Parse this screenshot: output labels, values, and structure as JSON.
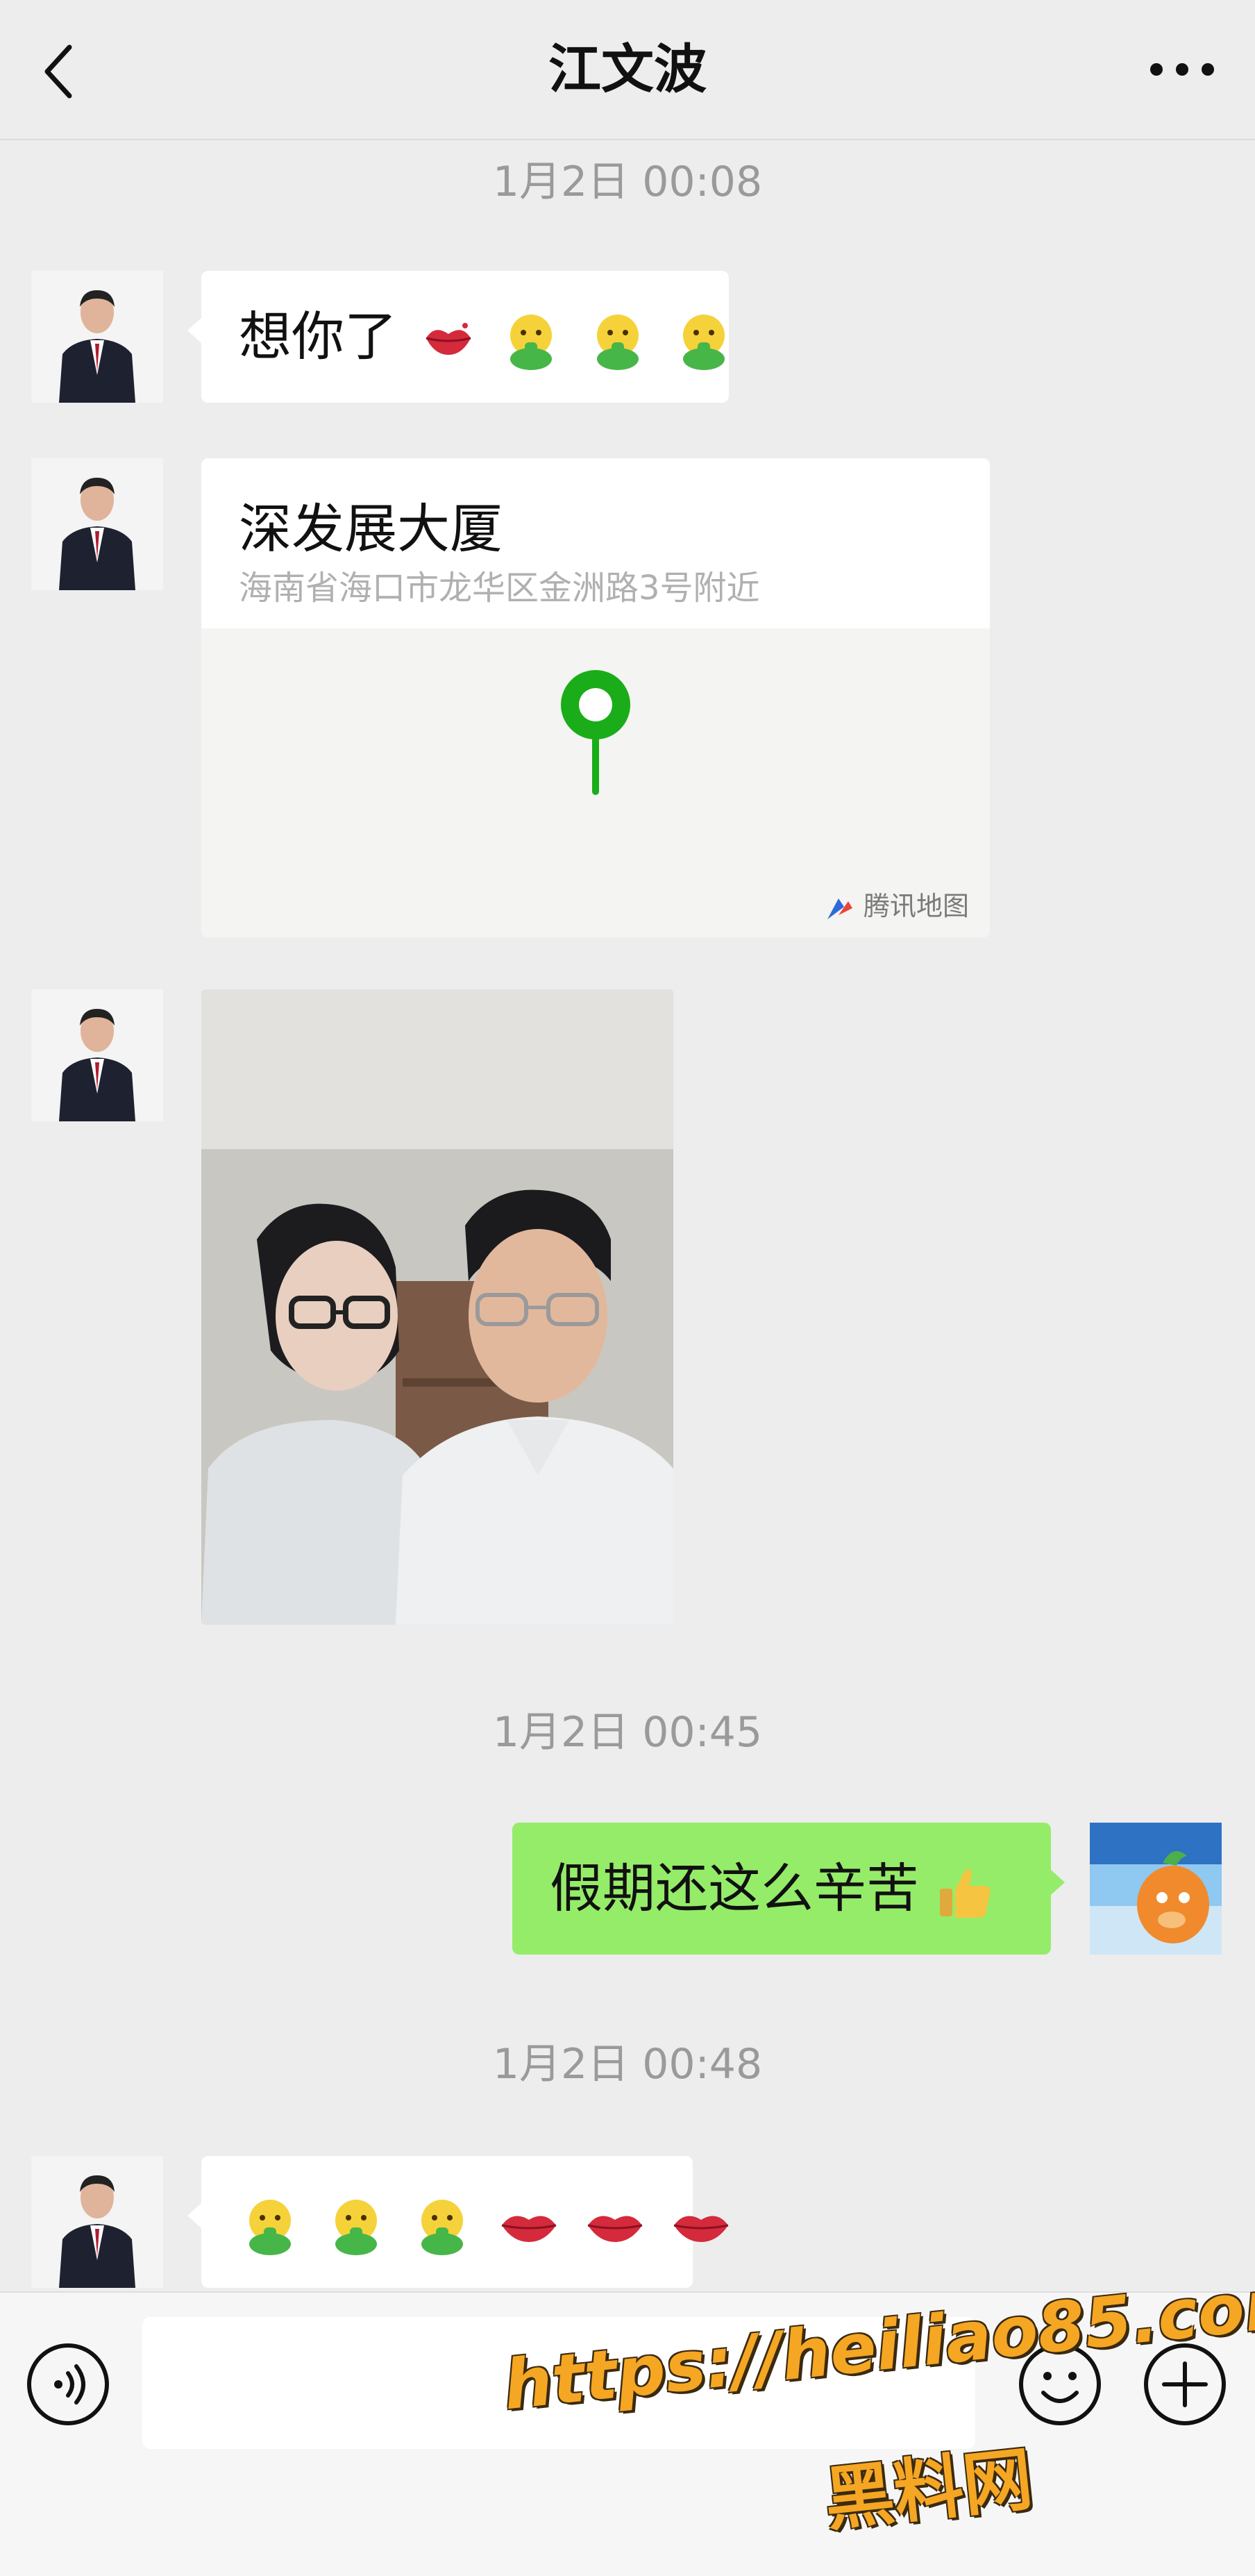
{
  "header": {
    "title": "江文波",
    "back_icon": "chevron-left-icon",
    "more_icon": "more-dots-icon"
  },
  "messages": [
    {
      "type": "timestamp",
      "text": "1月2日 00:08"
    },
    {
      "type": "text",
      "sender": "contact",
      "text": "想你了",
      "emojis": [
        "lips-kiss",
        "face-vomiting",
        "face-vomiting",
        "face-vomiting"
      ]
    },
    {
      "type": "location",
      "sender": "contact",
      "name": "深发展大厦",
      "address": "海南省海口市龙华区金洲路3号附近",
      "map_brand": "腾讯地图"
    },
    {
      "type": "image",
      "sender": "contact",
      "description_icon": "selfie-photo"
    },
    {
      "type": "timestamp",
      "text": "1月2日 00:45"
    },
    {
      "type": "text",
      "sender": "me",
      "text": "假期还这么辛苦",
      "emojis": [
        "thumbs-up"
      ]
    },
    {
      "type": "timestamp",
      "text": "1月2日 00:48"
    },
    {
      "type": "text",
      "sender": "contact",
      "text": "",
      "emojis": [
        "face-vomiting",
        "face-vomiting",
        "face-vomiting",
        "lips",
        "lips",
        "lips"
      ]
    }
  ],
  "input_bar": {
    "voice_icon": "voice-icon",
    "emoji_icon": "emoji-icon",
    "plus_icon": "plus-icon",
    "value": ""
  },
  "watermark": {
    "line1": "https://heiliao85.com",
    "line2": "黑料网"
  },
  "colors": {
    "background": "#ededed",
    "bubble_contact": "#ffffff",
    "bubble_me": "#95ec69",
    "timestamp": "#9a9a9a",
    "map_pin": "#1aad19",
    "watermark": "#f5a623"
  }
}
